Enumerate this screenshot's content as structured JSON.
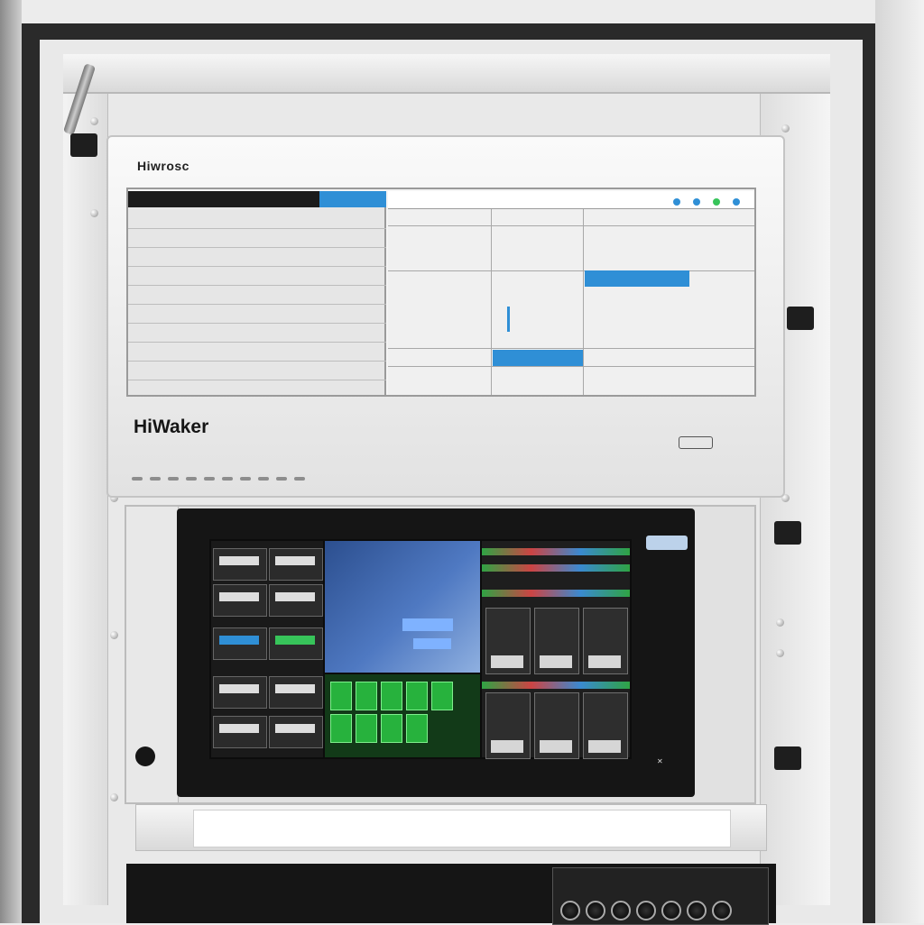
{
  "upper_unit": {
    "brand_small": "Hiwrosc",
    "brand_large": "HiWaker"
  },
  "colors": {
    "accent_blue": "#2f8fd6",
    "screen_green": "#27b23d",
    "frame_dark": "#1b1b1b"
  },
  "icons": {
    "upper_led_row": "status-led-icon",
    "monitor_logo": "brand-logo-icon",
    "screw": "screw-icon"
  }
}
